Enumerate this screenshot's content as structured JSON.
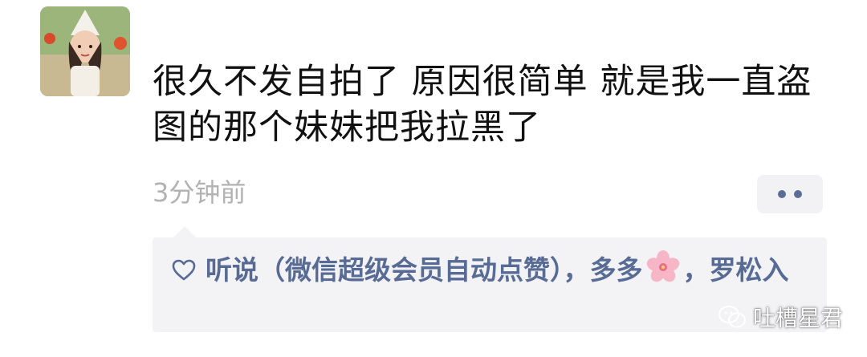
{
  "post": {
    "text": "很久不发自拍了 原因很简单 就是我一直盗图的那个妹妹把我拉黑了",
    "time": "3分钟前"
  },
  "likes": {
    "names_part1": "听说（微信超级会员自动点赞），多多",
    "names_part2": "，罗松入"
  },
  "watermark": {
    "text": "吐槽星君"
  },
  "icons": {
    "avatar": "avatar-photo",
    "more": "more-dots-icon",
    "like": "heart-outline-icon",
    "emoji": "cherry-blossom-icon",
    "watermark": "wechat-icon"
  },
  "colors": {
    "link": "#576b95",
    "time": "#b2b2b2",
    "like_bg": "#f3f3f5"
  }
}
